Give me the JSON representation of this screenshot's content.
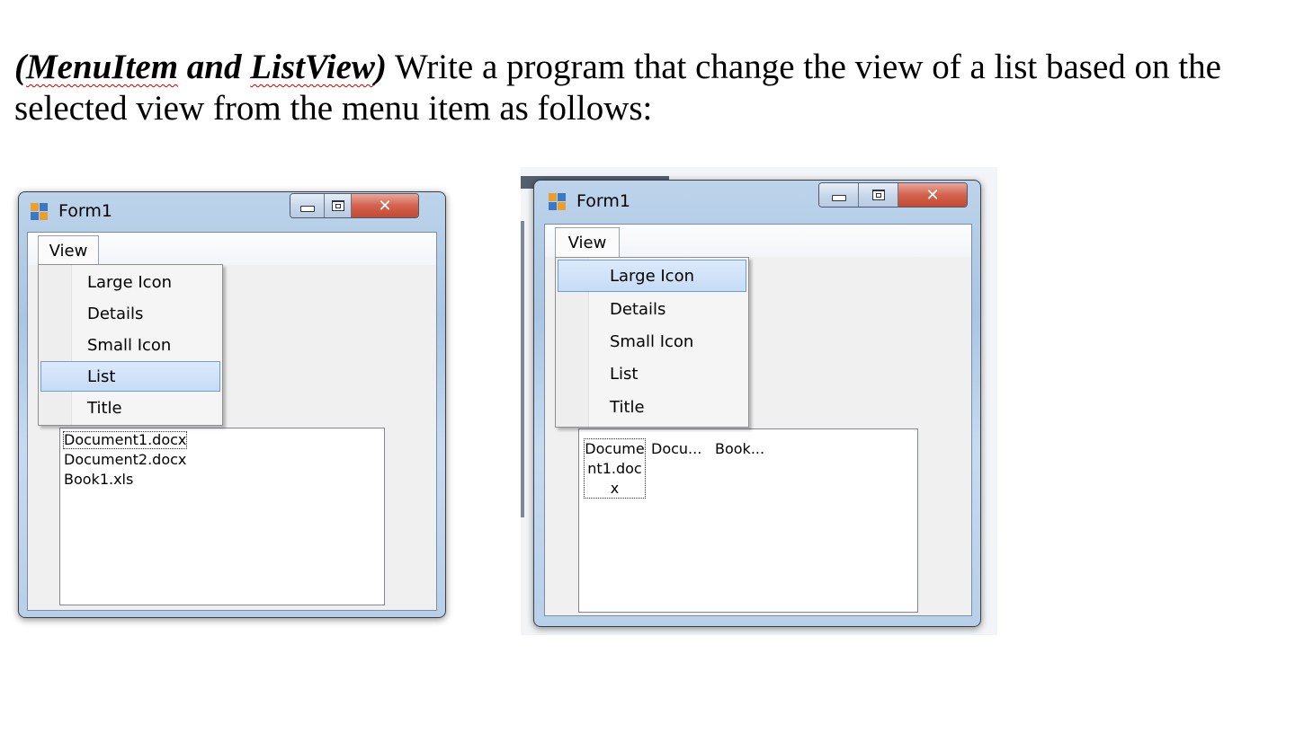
{
  "heading": {
    "lead_open": "(",
    "lead_word1": "MenuItem",
    "lead_mid": " and ",
    "lead_word2": "ListView",
    "lead_close": ")",
    "text": " Write a program that change the view of a list based on the selected view from the menu item as follows:"
  },
  "screens": [
    {
      "window_title": "Form1",
      "menu_label": "View",
      "menu_items": [
        "Large Icon",
        "Details",
        "Small Icon",
        "List",
        "Title"
      ],
      "selected_item": "List",
      "list_items": [
        "Document1.docx",
        "Document2.docx",
        "Book1.xls"
      ]
    },
    {
      "window_title": "Form1",
      "menu_label": "View",
      "menu_items": [
        "Large Icon",
        "Details",
        "Small Icon",
        "List",
        "Title"
      ],
      "selected_item": "Large Icon",
      "list_items": {
        "item1_lines": [
          "Docume",
          "nt1.doc",
          "x"
        ],
        "item2": "Docu...",
        "item3": "Book..."
      }
    }
  ],
  "colors": {
    "selection_bg": "#c6dcf6",
    "selection_border": "#6e9fd6",
    "close_button": "#c44a33",
    "frame": "#a9c6e4",
    "squiggle": "#c00000"
  },
  "icons": [
    "app-icon",
    "minimize-icon",
    "maximize-icon",
    "close-icon"
  ]
}
